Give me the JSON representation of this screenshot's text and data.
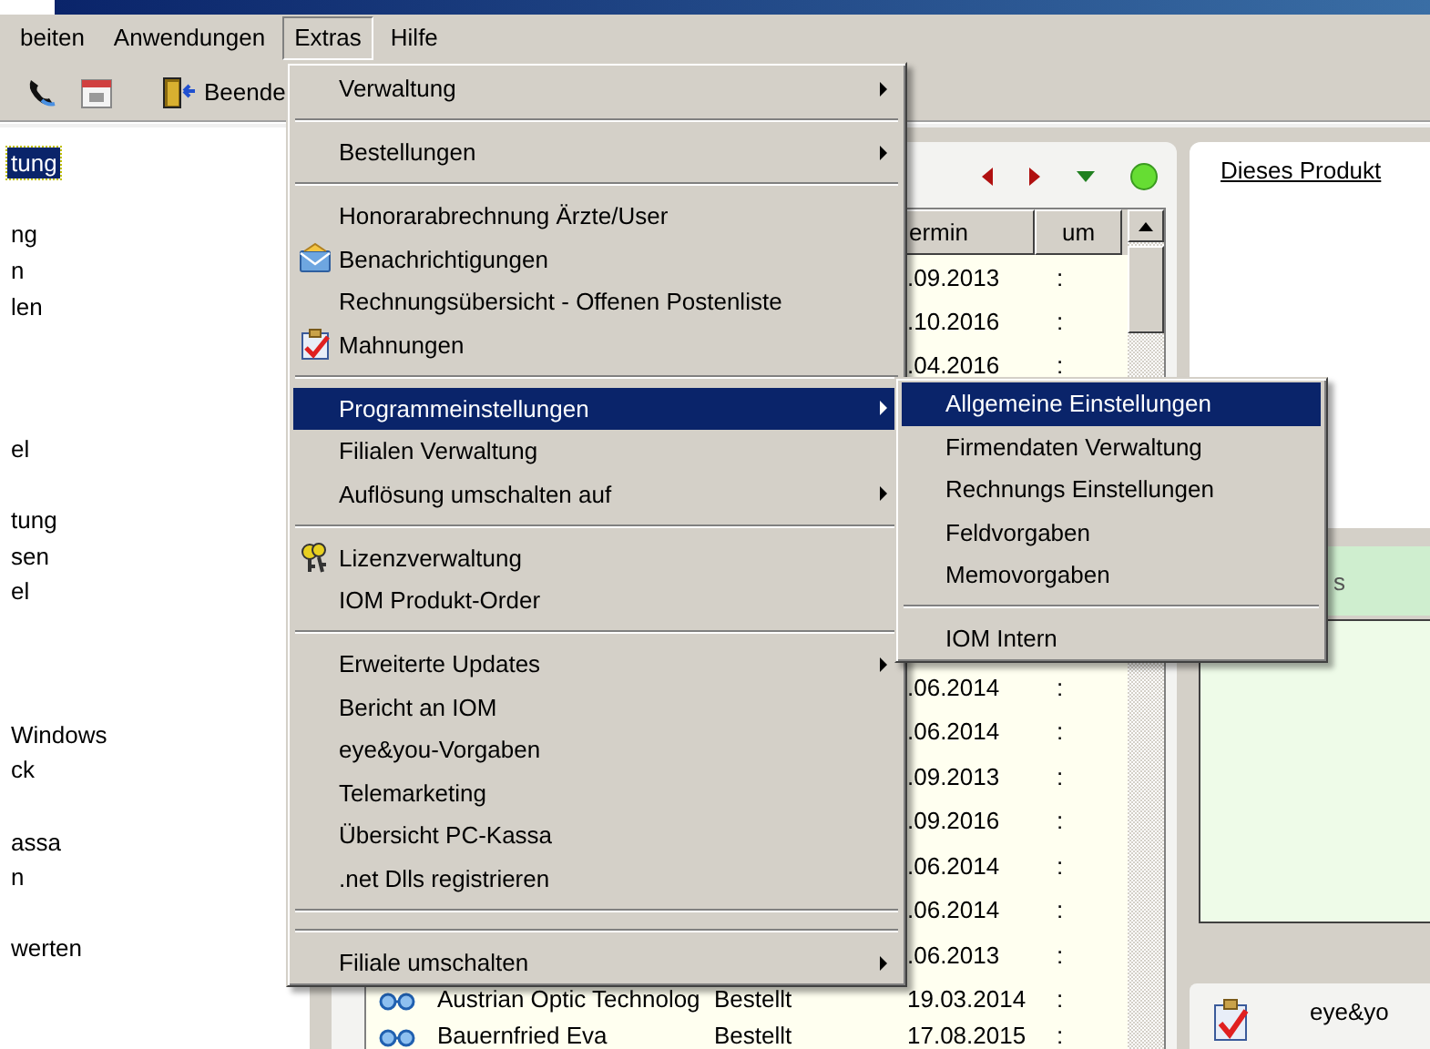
{
  "menubar": [
    {
      "label": "beiten",
      "selected": false
    },
    {
      "label": "Anwendungen",
      "selected": false
    },
    {
      "label": "Extras",
      "selected": true
    },
    {
      "label": "Hilfe",
      "selected": false
    }
  ],
  "toolbar": {
    "exit_label": "Beende"
  },
  "side_list": [
    {
      "label": "tung",
      "selected": true
    },
    {
      "label": "ng",
      "selected": false
    },
    {
      "label": "n",
      "selected": false
    },
    {
      "label": "len",
      "selected": false
    },
    {
      "label": "el",
      "selected": false
    },
    {
      "label": "tung",
      "selected": false
    },
    {
      "label": "sen",
      "selected": false
    },
    {
      "label": "el",
      "selected": false
    },
    {
      "label": "Windows",
      "selected": false
    },
    {
      "label": "ck",
      "selected": false
    },
    {
      "label": "assa",
      "selected": false
    },
    {
      "label": "n",
      "selected": false
    },
    {
      "label": "werten",
      "selected": false
    }
  ],
  "table": {
    "columns": [
      "ermin",
      "um"
    ],
    "rows_top": [
      {
        "date": ".09.2013",
        "time": ":"
      },
      {
        "date": ".10.2016",
        "time": ":"
      },
      {
        "date": ".04.2016",
        "time": ":"
      }
    ],
    "rows_bottom": [
      {
        "date": ".06.2014",
        "time": ":"
      },
      {
        "date": ".06.2014",
        "time": ":"
      },
      {
        "date": ".09.2013",
        "time": ":"
      },
      {
        "date": ".09.2016",
        "time": ":"
      },
      {
        "date": ".06.2014",
        "time": ":"
      },
      {
        "date": ".06.2014",
        "time": ":"
      },
      {
        "date": ".06.2013",
        "time": ":"
      },
      {
        "name": "Austrian Optic Technolog",
        "status": "Bestellt",
        "date": "19.03.2014",
        "time": ":"
      },
      {
        "name": "Bauernfried Eva",
        "status": "Bestellt",
        "date": "17.08.2015",
        "time": ":"
      }
    ]
  },
  "info_panel": {
    "link": "Dieses Produkt",
    "section_label": "s",
    "card_label": "eye&yo"
  },
  "extras_menu": [
    {
      "kind": "item",
      "label": "Verwaltung",
      "submenu": true,
      "selected": false
    },
    {
      "kind": "separator"
    },
    {
      "kind": "item",
      "label": "Bestellungen",
      "submenu": true,
      "selected": false
    },
    {
      "kind": "separator"
    },
    {
      "kind": "item",
      "label": "Honorarabrechnung Ärzte/User",
      "submenu": false,
      "selected": false
    },
    {
      "kind": "item",
      "label": "Benachrichtigungen",
      "submenu": false,
      "selected": false
    },
    {
      "kind": "item",
      "label": "Rechnungsübersicht - Offenen Postenliste",
      "submenu": false,
      "selected": false
    },
    {
      "kind": "item",
      "label": "Mahnungen",
      "submenu": false,
      "selected": false
    },
    {
      "kind": "separator"
    },
    {
      "kind": "item",
      "label": "Programmeinstellungen",
      "submenu": true,
      "selected": true
    },
    {
      "kind": "item",
      "label": "Filialen Verwaltung",
      "submenu": false,
      "selected": false
    },
    {
      "kind": "item",
      "label": "Auflösung umschalten auf",
      "submenu": true,
      "selected": false
    },
    {
      "kind": "separator"
    },
    {
      "kind": "item",
      "label": "Lizenzverwaltung",
      "submenu": false,
      "selected": false
    },
    {
      "kind": "item",
      "label": "IOM Produkt-Order",
      "submenu": false,
      "selected": false
    },
    {
      "kind": "separator"
    },
    {
      "kind": "item",
      "label": "Erweiterte Updates",
      "submenu": true,
      "selected": false
    },
    {
      "kind": "item",
      "label": "Bericht an IOM",
      "submenu": false,
      "selected": false
    },
    {
      "kind": "item",
      "label": "eye&you-Vorgaben",
      "submenu": false,
      "selected": false
    },
    {
      "kind": "item",
      "label": "Telemarketing",
      "submenu": false,
      "selected": false
    },
    {
      "kind": "item",
      "label": "Übersicht PC-Kassa",
      "submenu": false,
      "selected": false
    },
    {
      "kind": "item",
      "label": ".net Dlls registrieren",
      "submenu": false,
      "selected": false
    },
    {
      "kind": "separator"
    },
    {
      "kind": "separator"
    },
    {
      "kind": "item",
      "label": "Filiale umschalten",
      "submenu": true,
      "selected": false
    }
  ],
  "settings_submenu": [
    {
      "kind": "item",
      "label": "Allgemeine Einstellungen",
      "submenu": false,
      "selected": true
    },
    {
      "kind": "item",
      "label": "Firmendaten Verwaltung",
      "submenu": false,
      "selected": false
    },
    {
      "kind": "item",
      "label": "Rechnungs Einstellungen",
      "submenu": false,
      "selected": false
    },
    {
      "kind": "item",
      "label": "Feldvorgaben",
      "submenu": false,
      "selected": false
    },
    {
      "kind": "item",
      "label": "Memovorgaben",
      "submenu": false,
      "selected": false
    },
    {
      "kind": "separator"
    },
    {
      "kind": "item",
      "label": "IOM Intern",
      "submenu": false,
      "selected": false
    }
  ]
}
